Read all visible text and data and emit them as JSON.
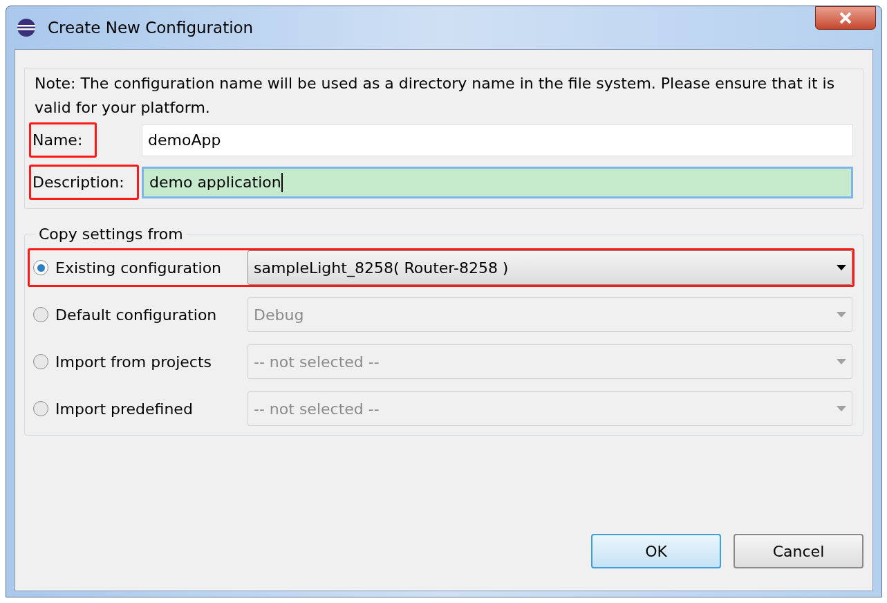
{
  "window": {
    "title": "Create New Configuration"
  },
  "note": "Note: The configuration name will be used as a directory name in the file system.  Please ensure that it is valid for your platform.",
  "fields": [
    {
      "label": "Name:",
      "value": "demoApp",
      "focused": false,
      "highlighted": true
    },
    {
      "label": "Description:",
      "value": "demo application",
      "focused": true,
      "highlighted": true
    }
  ],
  "copy_settings": {
    "title": "Copy settings from",
    "options": [
      {
        "label": "Existing configuration",
        "selected": true,
        "value": "sampleLight_8258( Router-8258 )",
        "disabled": false,
        "highlighted": true
      },
      {
        "label": "Default configuration",
        "selected": false,
        "value": "Debug",
        "disabled": true,
        "highlighted": false
      },
      {
        "label": "Import from projects",
        "selected": false,
        "value": "-- not selected --",
        "disabled": true,
        "highlighted": false
      },
      {
        "label": "Import predefined",
        "selected": false,
        "value": "-- not selected --",
        "disabled": true,
        "highlighted": false
      }
    ]
  },
  "buttons": [
    {
      "label": "OK",
      "default": true
    },
    {
      "label": "Cancel",
      "default": false
    }
  ]
}
